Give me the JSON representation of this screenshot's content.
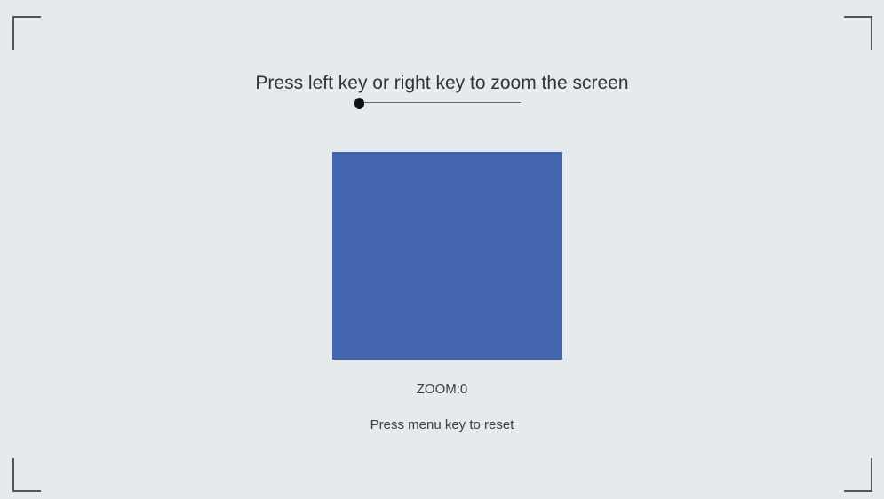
{
  "screen": {
    "instruction": "Press left key or right key to zoom the screen",
    "zoom_label": "ZOOM:0",
    "reset_hint": "Press menu key to reset",
    "zoom_level_fraction": 0.0,
    "square_color": "#4466b1",
    "background_color": "#e7eaed"
  }
}
